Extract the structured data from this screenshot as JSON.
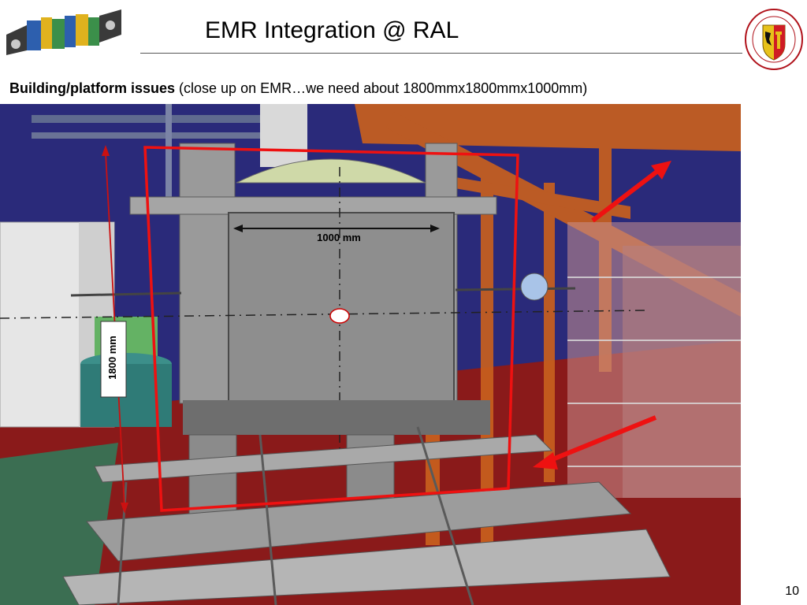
{
  "slide": {
    "title": "EMR Integration @ RAL",
    "subtitle_bold": "Building/platform issues",
    "subtitle_rest": " (close up on EMR…we need about 1800mmx1800mmx1000mm)",
    "page_number": "10"
  },
  "render": {
    "width_label": "1000 mm",
    "height_label": "1800 mm"
  },
  "logo_right": {
    "text": "SCHOLA GENEVENSIS",
    "year": "1559"
  },
  "colors": {
    "annotation_red": "#ee1111",
    "floor_red": "#8a1a1a",
    "wall_blue": "#2a2a7a",
    "frame_orange": "#c8601e",
    "panel_gray": "#8e8e8e"
  }
}
